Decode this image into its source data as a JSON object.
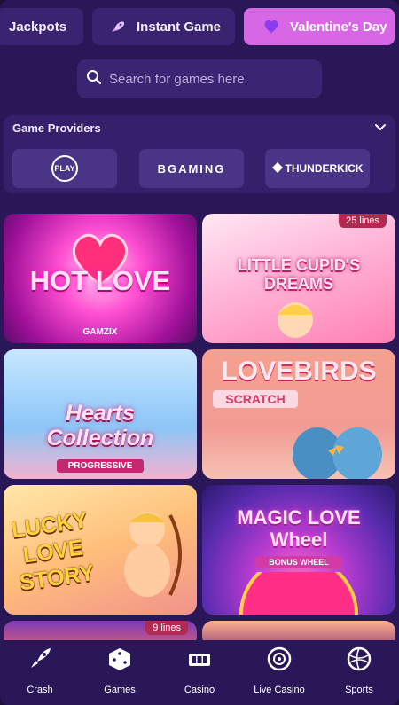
{
  "tabs": [
    {
      "label": "Jackpots"
    },
    {
      "label": "Instant Game",
      "icon": "rocket-icon"
    },
    {
      "label": "Valentine's Day",
      "icon": "heart-icon",
      "active": true
    }
  ],
  "search": {
    "placeholder": "Search for games here"
  },
  "providers": {
    "title": "Game Providers",
    "logos": [
      {
        "name": "Pragmatic Play",
        "text": "PLAY"
      },
      {
        "name": "BGaming",
        "text": "BGAMING"
      },
      {
        "name": "Thunderkick",
        "text": "THUNDERKICK"
      }
    ]
  },
  "games": [
    {
      "title": "HOT LOVE",
      "provider": "GAMZIX"
    },
    {
      "title": "LITTLE CUPID'S DREAMS",
      "badge": "25 lines"
    },
    {
      "title": "Hearts Collection",
      "subtitle": "PROGRESSIVE"
    },
    {
      "title": "LOVEBIRDS",
      "subtitle": "SCRATCH"
    },
    {
      "title": "LUCKY LOVE STORY"
    },
    {
      "title": "MAGIC LOVE Wheel",
      "subtitle": "BONUS WHEEL"
    },
    {
      "badge": "9 lines"
    },
    {}
  ],
  "nav": [
    {
      "label": "Crash",
      "icon": "rocket-icon"
    },
    {
      "label": "Games",
      "icon": "dice-icon"
    },
    {
      "label": "Casino",
      "icon": "slot-machine-icon"
    },
    {
      "label": "Live Casino",
      "icon": "roulette-icon"
    },
    {
      "label": "Sports",
      "icon": "ball-icon"
    }
  ],
  "colors": {
    "accent": "#d867e6",
    "background": "#2a1758",
    "card": "#3a2370"
  }
}
